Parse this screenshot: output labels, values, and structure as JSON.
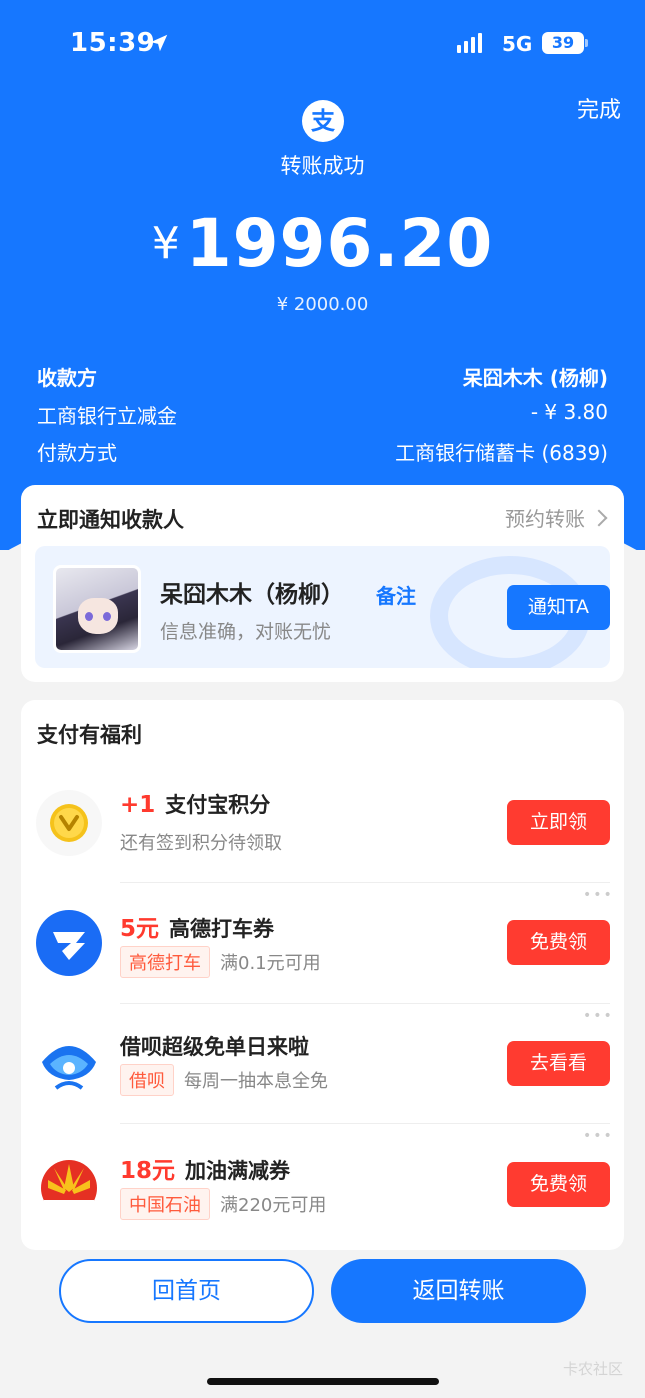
{
  "status_bar": {
    "time": "15:39",
    "network": "5G",
    "battery": "39"
  },
  "header": {
    "done_label": "完成",
    "logo_glyph": "支",
    "status_text": "转账成功",
    "currency": "¥",
    "amount": "1996.20",
    "original_amount": "¥ 2000.00"
  },
  "details": [
    {
      "label": "收款方",
      "value": "呆囧木木 (杨柳)"
    },
    {
      "label": "工商银行立减金",
      "value": "- ¥ 3.80"
    },
    {
      "label": "付款方式",
      "value": "工商银行储蓄卡 (6839)"
    }
  ],
  "notify": {
    "title": "立即通知收款人",
    "schedule_label": "预约转账",
    "payee_name": "呆囧木木（杨柳）",
    "remark_label": "备注",
    "subtitle": "信息准确，对账无忧",
    "button_label": "通知TA"
  },
  "benefits": {
    "title": "支付有福利",
    "items": [
      {
        "highlight": "+1",
        "title": "支付宝积分",
        "tag": "",
        "desc": "还有签到积分待领取",
        "button": "立即领",
        "icon": "coin-v-icon"
      },
      {
        "highlight": "5元",
        "title": "高德打车券",
        "tag": "高德打车",
        "desc": "满0.1元可用",
        "button": "免费领",
        "icon": "amap-logo-icon"
      },
      {
        "highlight": "",
        "title": "借呗超级免单日来啦",
        "tag": "借呗",
        "desc": "每周一抽本息全免",
        "button": "去看看",
        "icon": "jiebei-logo-icon"
      },
      {
        "highlight": "18元",
        "title": "加油满减券",
        "tag": "中国石油",
        "desc": "满220元可用",
        "button": "免费领",
        "icon": "petrochina-logo-icon"
      }
    ]
  },
  "footer": {
    "home_label": "回首页",
    "back_label": "返回转账"
  },
  "watermark": "卡农社区",
  "colors": {
    "primary": "#1677ff",
    "red": "#ff3b30",
    "background": "#f3f3f3"
  }
}
